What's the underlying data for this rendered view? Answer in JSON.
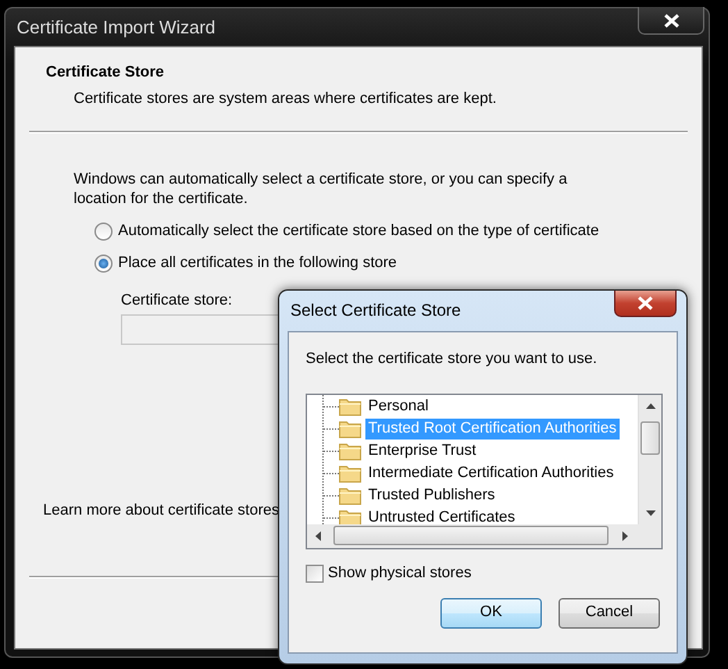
{
  "wizard": {
    "title": "Certificate Import Wizard",
    "heading": "Certificate Store",
    "subheading": "Certificate stores are system areas where certificates are kept.",
    "intro": "Windows can automatically select a certificate store, or you can specify a location for the certificate.",
    "options": [
      {
        "label": "Automatically select the certificate store based on the type of certificate",
        "selected": false
      },
      {
        "label": "Place all certificates in the following store",
        "selected": true
      }
    ],
    "store_label": "Certificate store:",
    "learn_more": "Learn more about ",
    "learn_more_link": "certificate stores"
  },
  "dialog": {
    "title": "Select Certificate Store",
    "prompt": "Select the certificate store you want to use.",
    "stores": [
      {
        "label": "Personal",
        "selected": false
      },
      {
        "label": "Trusted Root Certification Authorities",
        "selected": true
      },
      {
        "label": "Enterprise Trust",
        "selected": false
      },
      {
        "label": "Intermediate Certification Authorities",
        "selected": false
      },
      {
        "label": "Trusted Publishers",
        "selected": false
      },
      {
        "label": "Untrusted Certificates",
        "selected": false
      }
    ],
    "show_physical": {
      "label": "Show physical stores",
      "checked": false
    },
    "buttons": [
      {
        "label": "OK",
        "default": true
      },
      {
        "label": "Cancel",
        "default": false
      }
    ]
  }
}
